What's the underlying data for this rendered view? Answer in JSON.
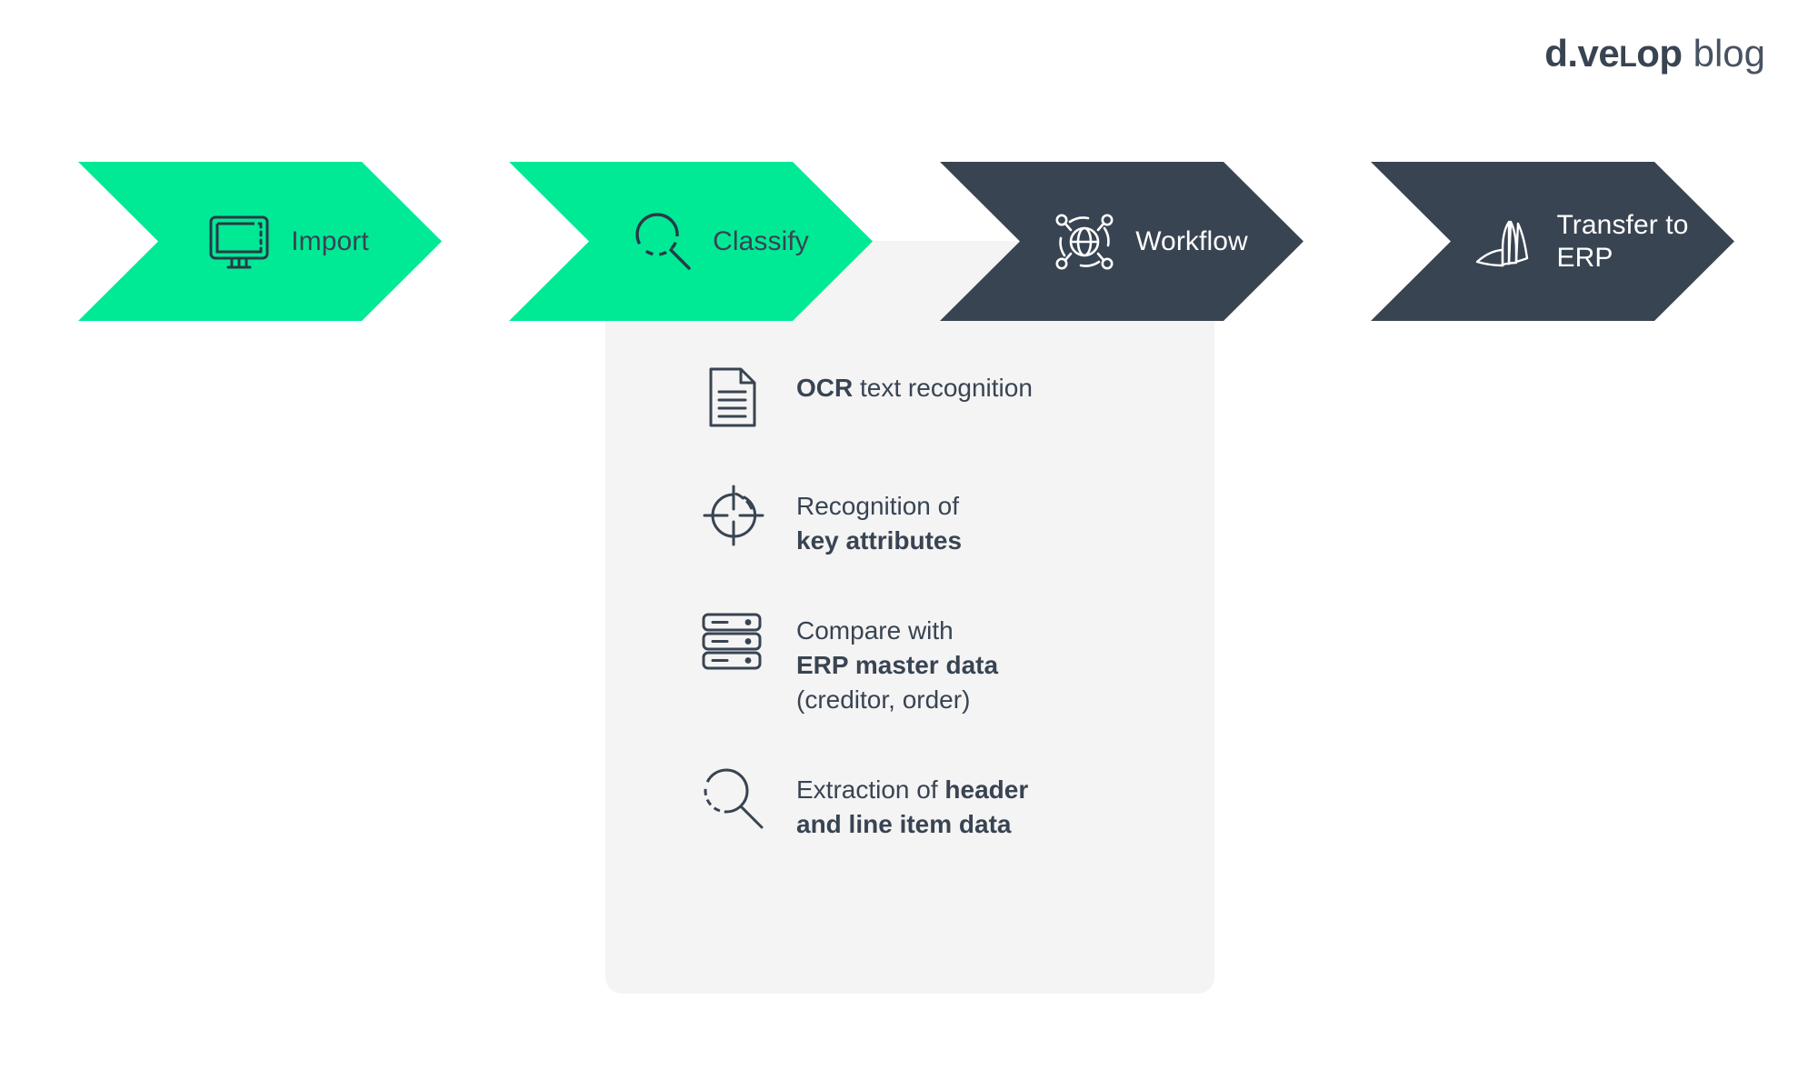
{
  "brand": {
    "name_part1": "d.ve",
    "name_smallcap": "L",
    "name_part2": "op",
    "sub": "blog"
  },
  "colors": {
    "green": "#00ea96",
    "dark": "#394452",
    "panel": "#f4f4f4",
    "background": "#ffffff"
  },
  "process": {
    "steps": [
      {
        "label": "Import",
        "icon": "monitor-icon",
        "style": "green"
      },
      {
        "label": "Classify",
        "icon": "magnifier-icon",
        "style": "green"
      },
      {
        "label": "Workflow",
        "icon": "network-globe-icon",
        "style": "dark"
      },
      {
        "label": "Transfer to\nERP",
        "icon": "erp-sails-icon",
        "style": "dark"
      }
    ]
  },
  "details": {
    "items": [
      {
        "icon": "document-lines-icon",
        "text_bold_1": "OCR",
        "text_normal_1": " text recognition",
        "text_bold_2": "",
        "text_normal_2": ""
      },
      {
        "icon": "crosshair-target-icon",
        "text_bold_1": "",
        "text_normal_1": "Recognition of\n",
        "text_bold_2": "key attributes",
        "text_normal_2": ""
      },
      {
        "icon": "server-stack-icon",
        "text_bold_1": "",
        "text_normal_1": "Compare with\n",
        "text_bold_2": "ERP master data",
        "text_normal_2": "\n(creditor, order)"
      },
      {
        "icon": "magnifier-icon",
        "text_bold_1": "",
        "text_normal_1": "Extraction of ",
        "text_bold_2": "header\nand line item data",
        "text_normal_2": ""
      }
    ]
  }
}
